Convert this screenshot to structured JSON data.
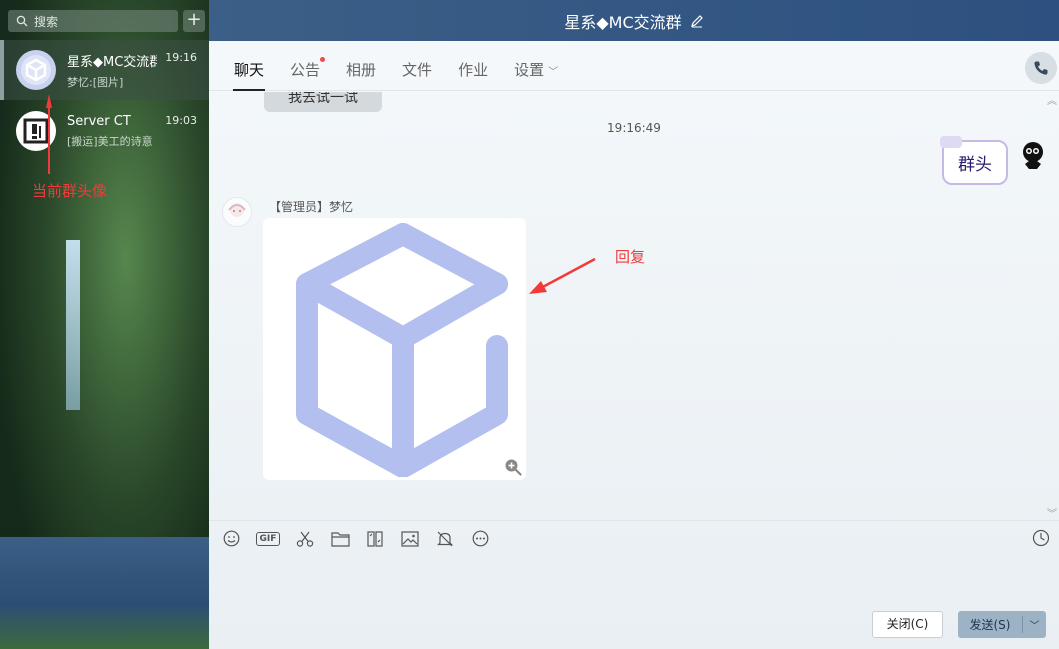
{
  "sidebar": {
    "search_placeholder": "搜索",
    "add_label": "+",
    "conversations": [
      {
        "name": "星系◆MC交流群",
        "time": "19:16",
        "preview": "梦忆:[图片]"
      },
      {
        "name": "Server CT",
        "time": "19:03",
        "preview": "[搬运]美工的诗意"
      }
    ],
    "annotation": "当前群头像"
  },
  "title": {
    "text": "星系◆MC交流群"
  },
  "tabs": [
    {
      "label": "聊天",
      "active": true
    },
    {
      "label": "公告",
      "has_dot": true
    },
    {
      "label": "相册"
    },
    {
      "label": "文件"
    },
    {
      "label": "作业"
    },
    {
      "label": "设置",
      "has_dropdown": true
    }
  ],
  "chat": {
    "partial_message": "我去试一试",
    "timestamp": "19:16:49",
    "self_message": "群头",
    "sender": {
      "role": "【管理员】",
      "name": "梦忆"
    },
    "image_alt": "cube-logo",
    "reply_annotation": "回复"
  },
  "toolbar": {
    "gif_label": "GIF",
    "icons": [
      "emoji-icon",
      "gif-icon",
      "scissors-icon",
      "folder-icon",
      "file-transfer-icon",
      "image-icon",
      "reminder-icon",
      "more-icon"
    ]
  },
  "buttons": {
    "close": "关闭(C)",
    "send": "发送(S)"
  },
  "colors": {
    "accent": "#2d5080",
    "cube": "#b3bfef",
    "annotation_red": "#f23a3a"
  }
}
